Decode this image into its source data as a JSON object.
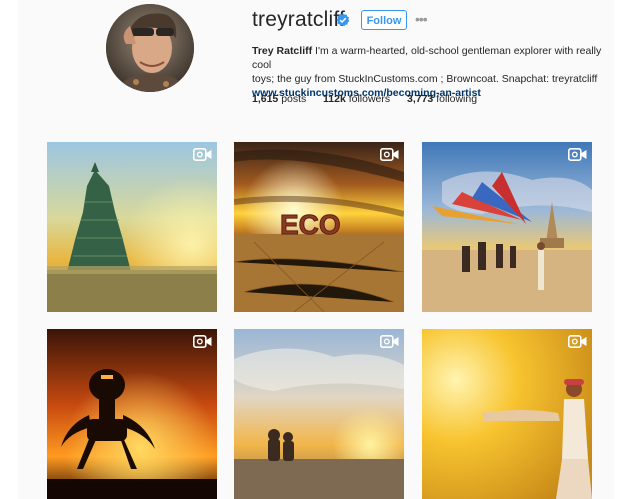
{
  "profile": {
    "username": "treyratcliff",
    "follow_label": "Follow",
    "more_label": "•••",
    "full_name": "Trey Ratcliff",
    "bio_line1": "I'm a warm-hearted, old-school gentleman explorer with really cool",
    "bio_line2": "toys; the guy from StuckInCustoms.com ; Browncoat. Snapchat: treyratcliff",
    "website": "www.stuckincustoms.com/becoming-an-artist"
  },
  "stats": {
    "posts_count": "1,615",
    "posts_label": "posts",
    "followers_count": "112k",
    "followers_label": "followers",
    "following_count": "3,773",
    "following_label": "following"
  },
  "posts": [
    {
      "icon": "video-camera-icon"
    },
    {
      "icon": "video-camera-icon"
    },
    {
      "icon": "video-camera-icon"
    },
    {
      "icon": "video-camera-icon"
    },
    {
      "icon": "video-camera-icon"
    },
    {
      "icon": "video-camera-icon"
    }
  ],
  "post_overlay_text": {
    "tile2_sign": "ECO"
  },
  "colors": {
    "accent": "#3897f0",
    "link": "#003569",
    "background": "#fafafa"
  }
}
